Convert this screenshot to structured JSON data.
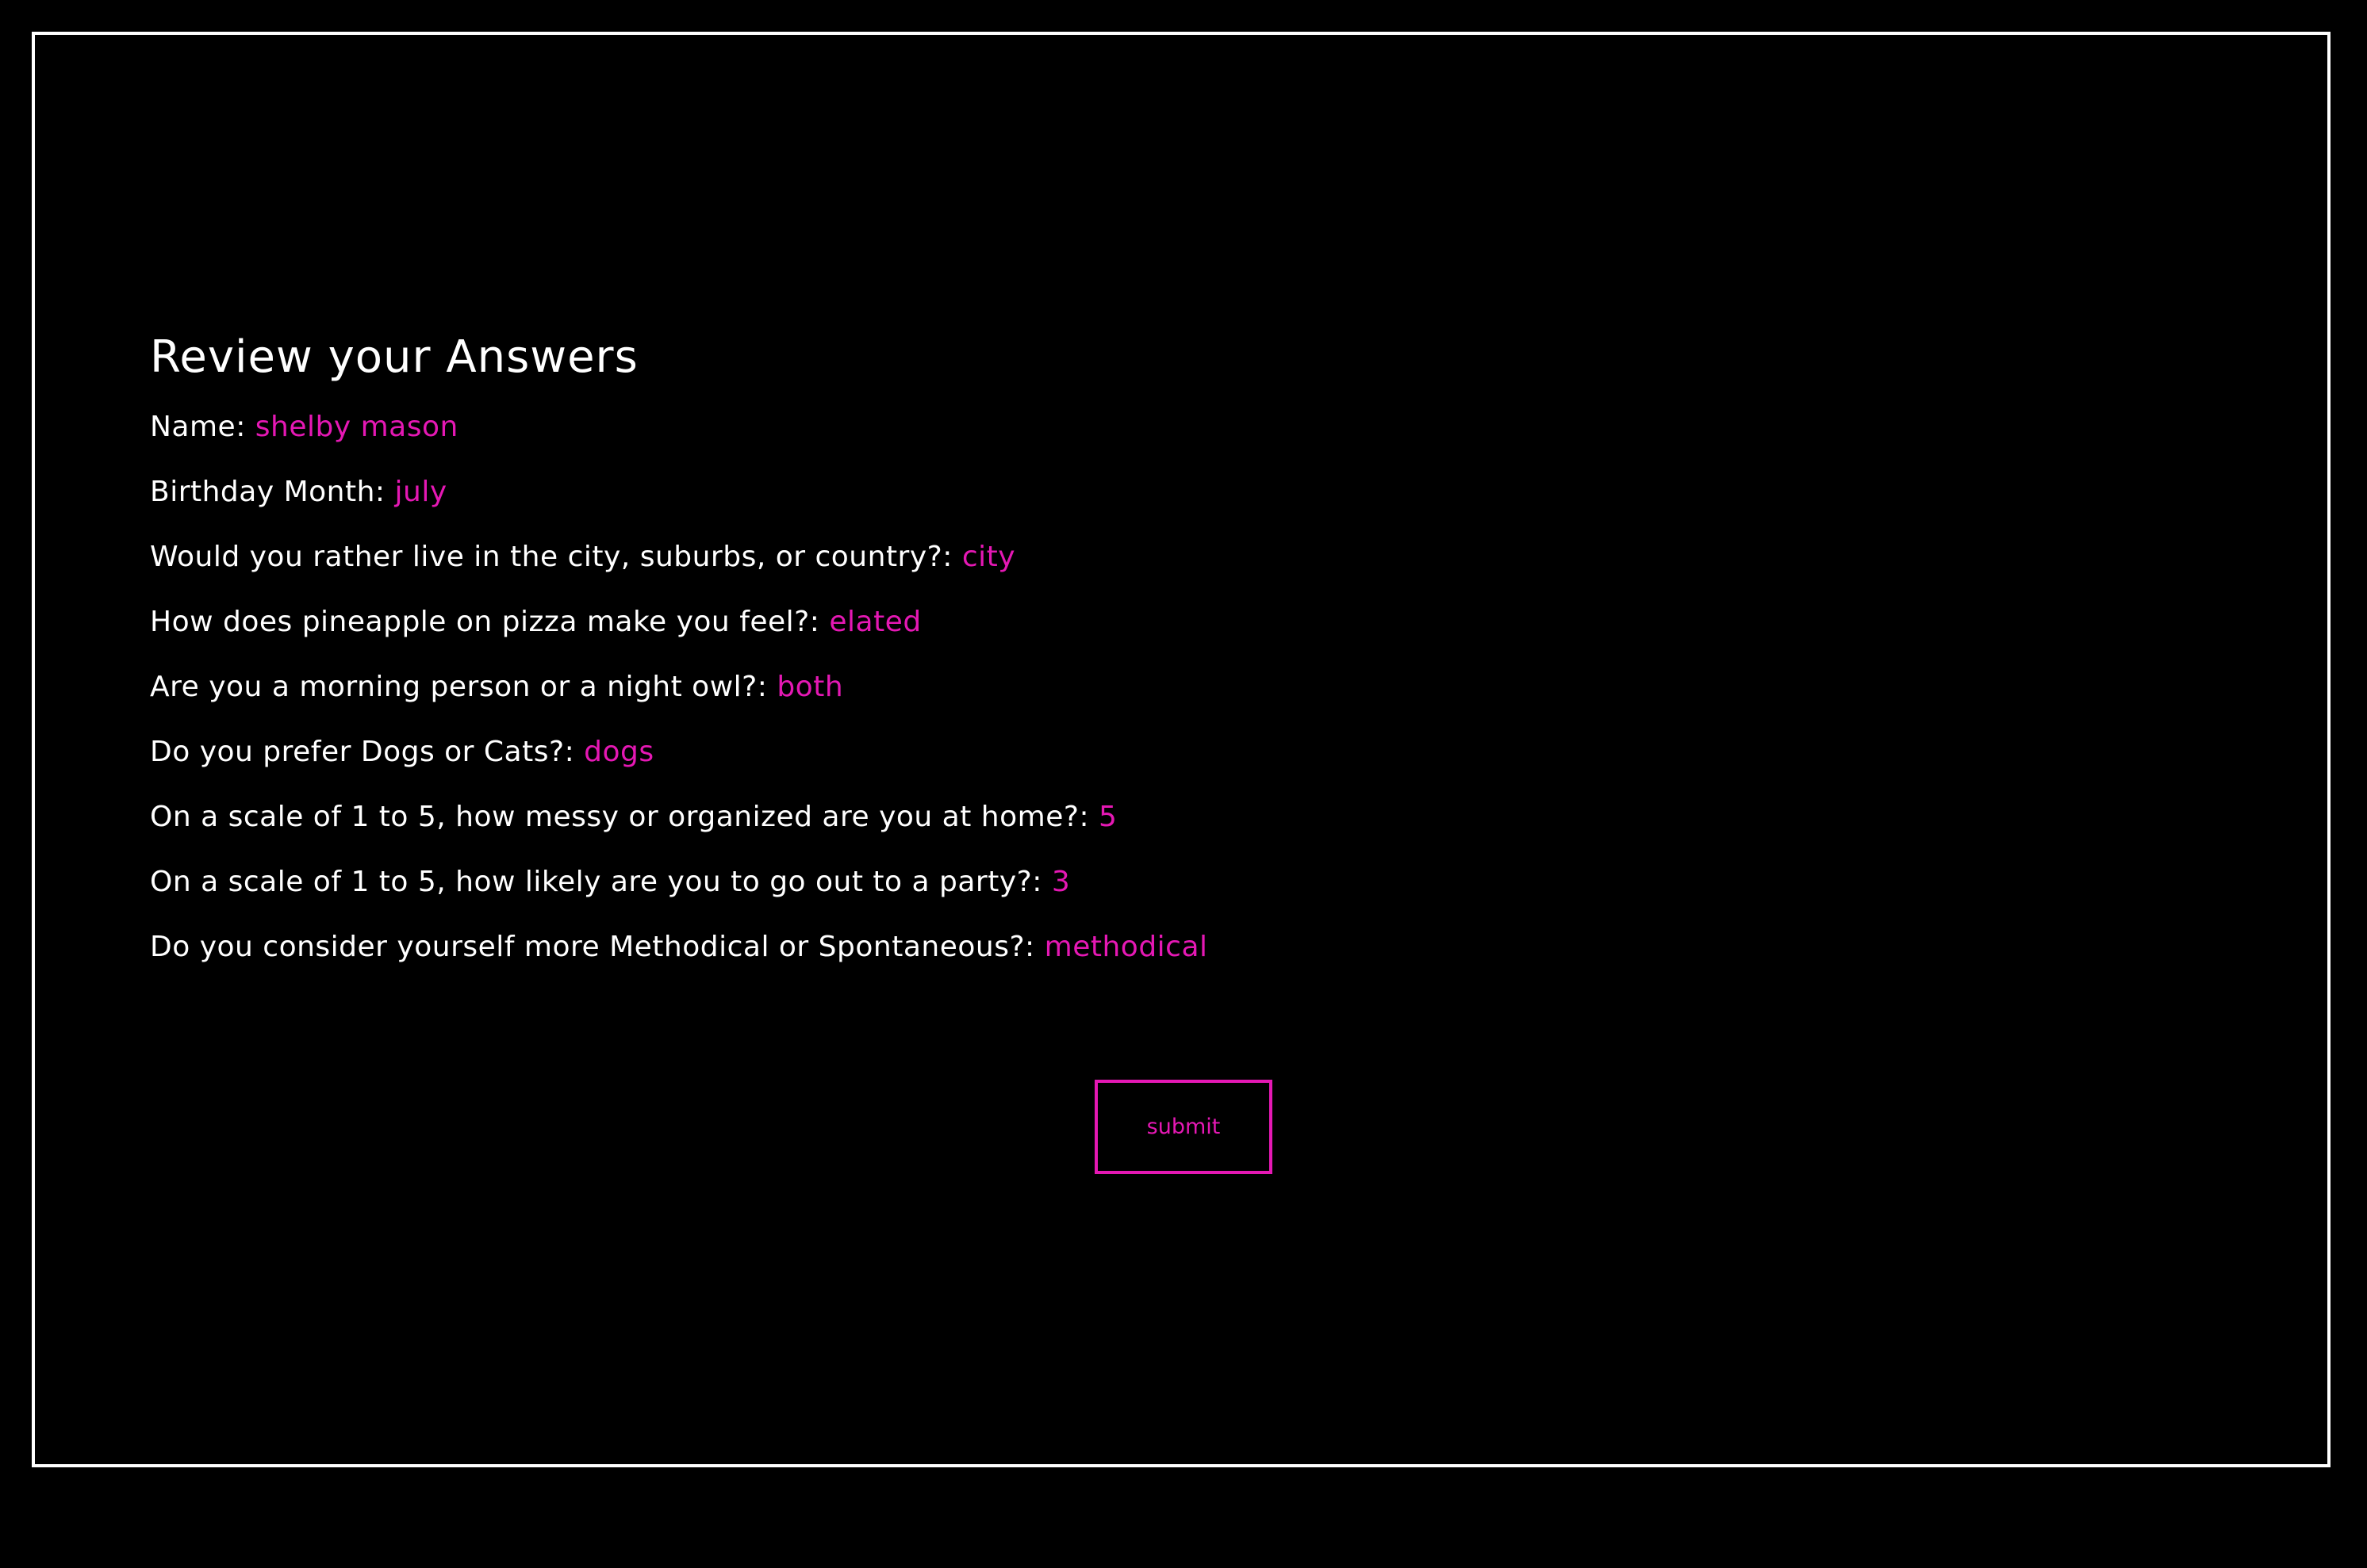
{
  "page": {
    "title": "Review your Answers"
  },
  "answers": [
    {
      "question": "Name:",
      "value": "shelby mason"
    },
    {
      "question": "Birthday Month:",
      "value": "july"
    },
    {
      "question": "Would you rather live in the city, suburbs, or country?:",
      "value": "city"
    },
    {
      "question": "How does pineapple on pizza make you feel?:",
      "value": "elated"
    },
    {
      "question": "Are you a morning person or a night owl?:",
      "value": "both"
    },
    {
      "question": "Do you prefer Dogs or Cats?:",
      "value": "dogs"
    },
    {
      "question": "On a scale of 1 to 5, how messy or organized are you at home?:",
      "value": "5"
    },
    {
      "question": "On a scale of 1 to 5, how likely are you to go out to a party?:",
      "value": "3"
    },
    {
      "question": "Do you consider yourself more Methodical or Spontaneous?:",
      "value": "methodical"
    }
  ],
  "actions": {
    "submit_label": "submit"
  },
  "colors": {
    "background": "#000000",
    "text": "#ffffff",
    "accent": "#e518b4"
  }
}
